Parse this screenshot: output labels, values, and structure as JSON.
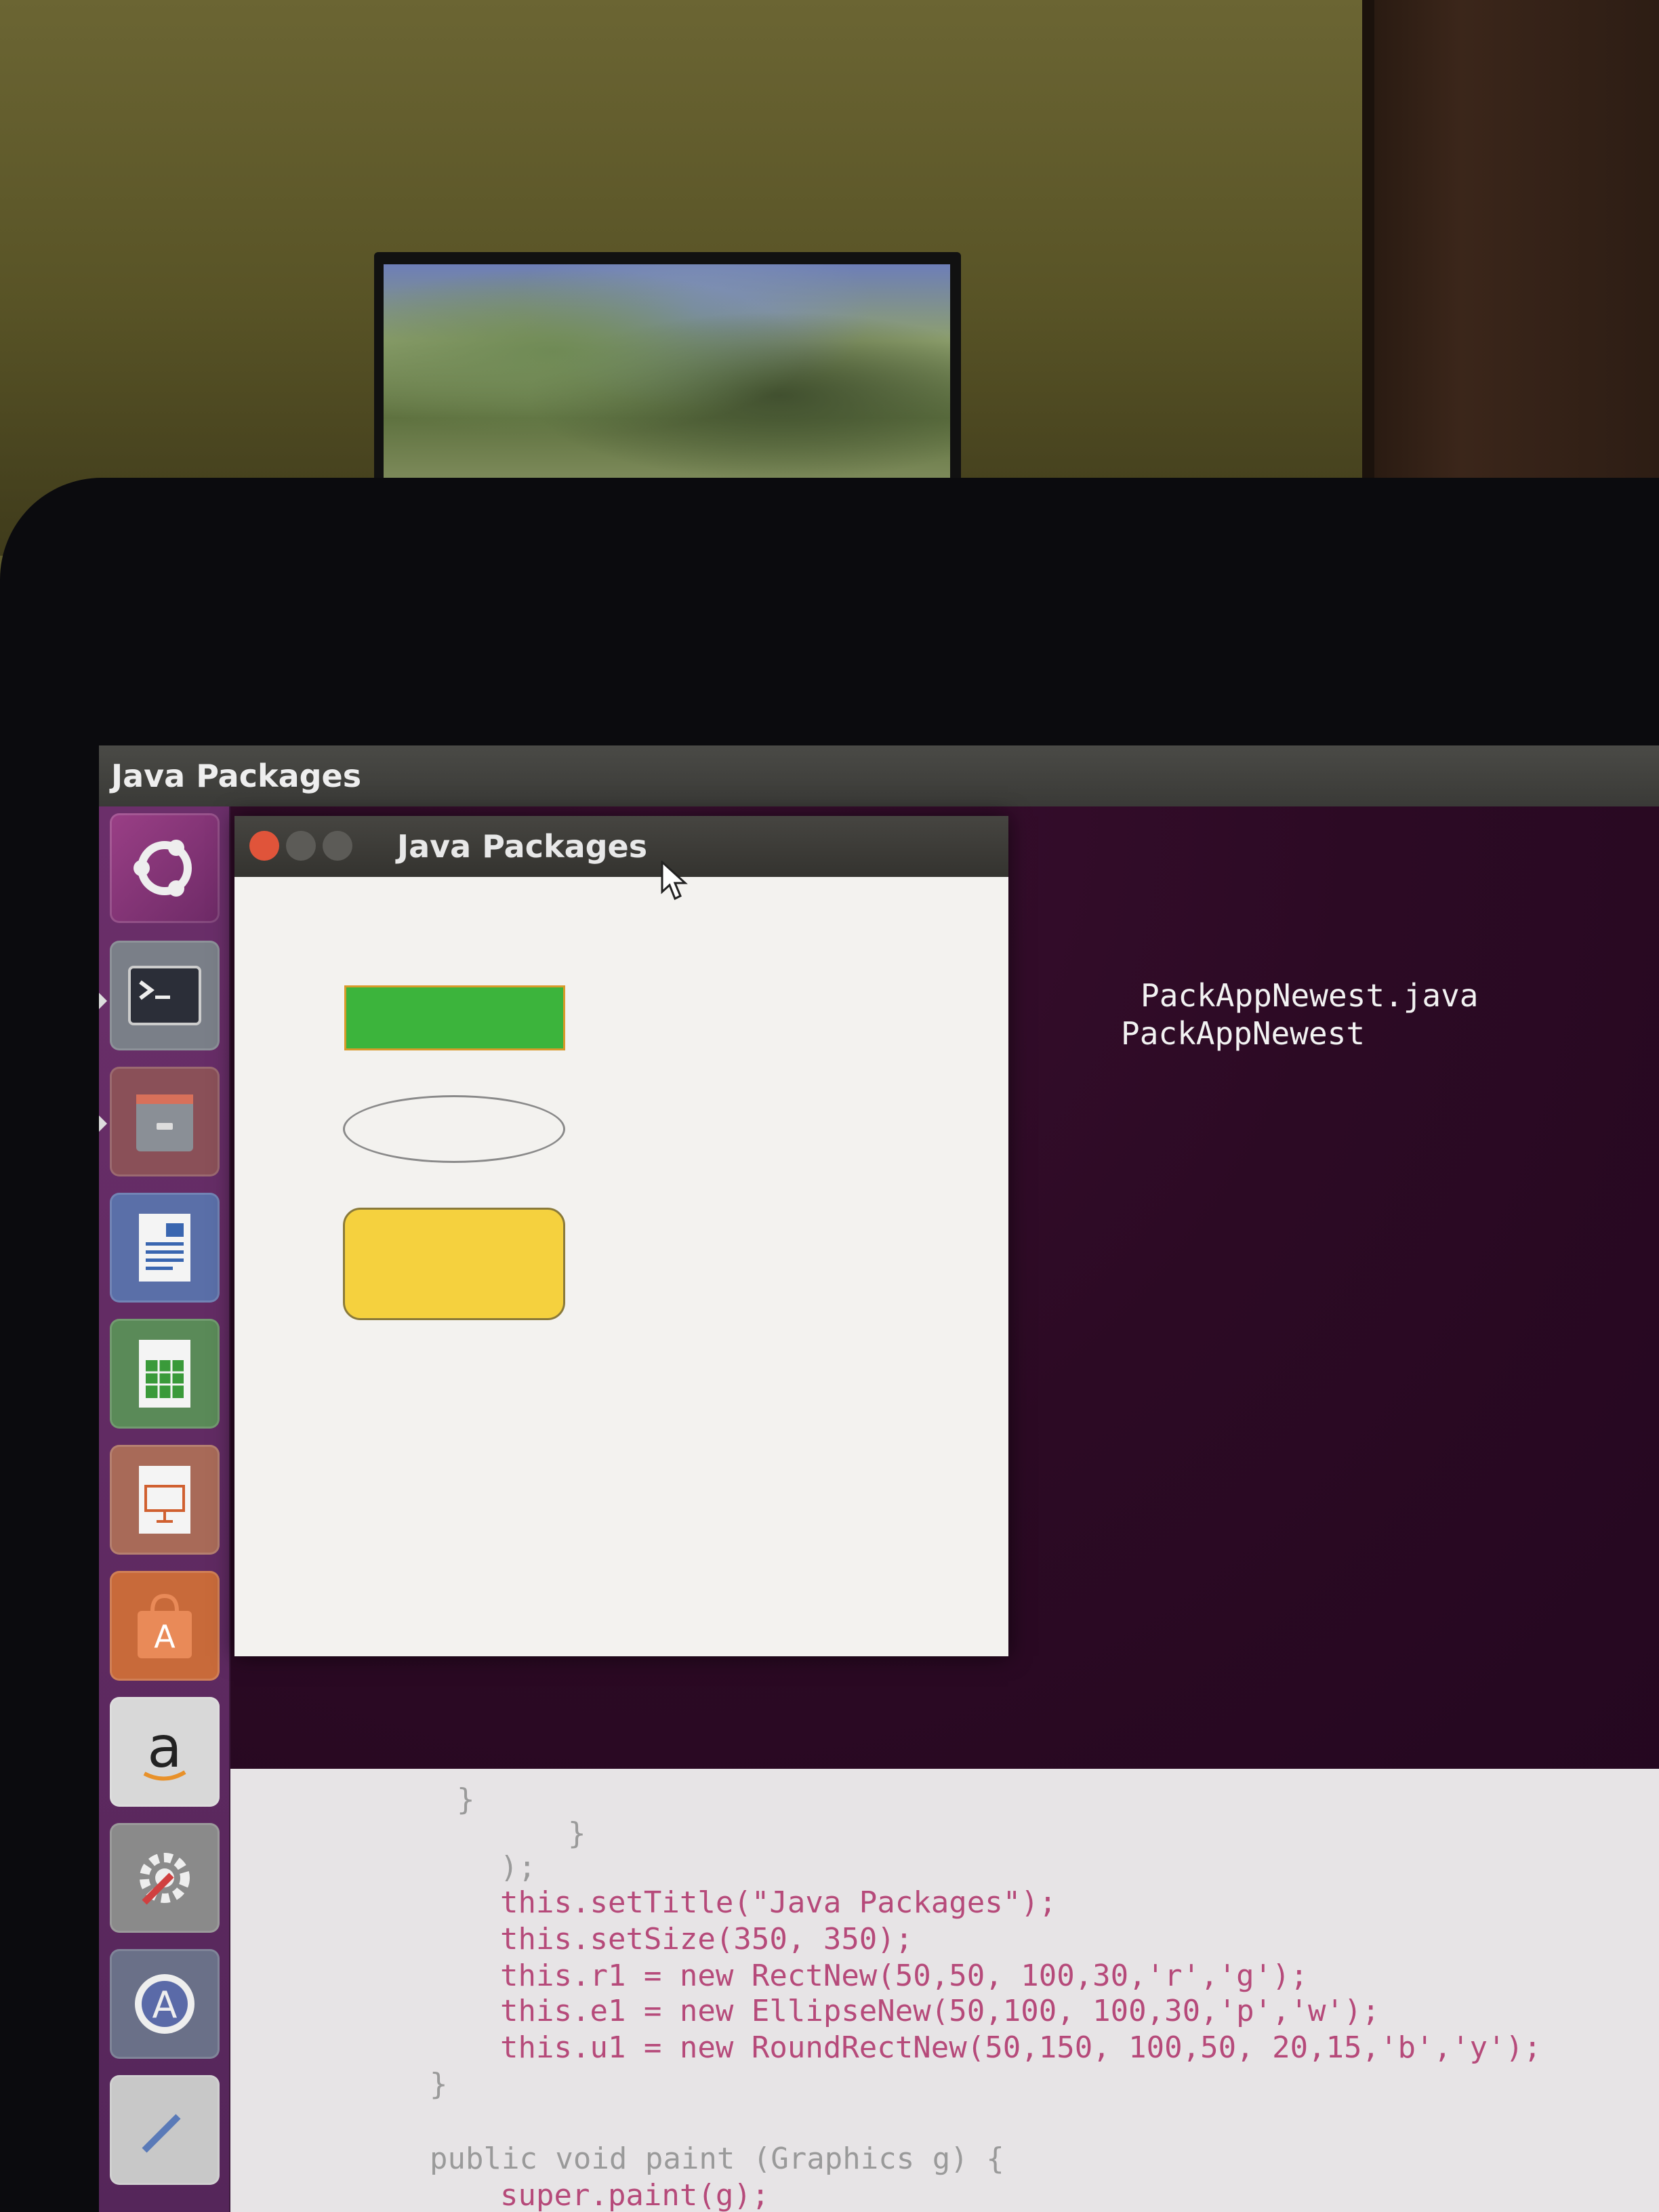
{
  "desktop": {
    "top_bar_title": "Java Packages"
  },
  "launcher": {
    "items": [
      {
        "name": "ubuntu-dash"
      },
      {
        "name": "terminal"
      },
      {
        "name": "files"
      },
      {
        "name": "libreoffice-writer"
      },
      {
        "name": "libreoffice-calc"
      },
      {
        "name": "libreoffice-impress"
      },
      {
        "name": "ubuntu-software-center"
      },
      {
        "name": "amazon"
      },
      {
        "name": "system-settings"
      },
      {
        "name": "software-updater"
      },
      {
        "name": "text-editor"
      }
    ]
  },
  "terminal": {
    "lines": [
      "PackAppNewest.java",
      "PackAppNewest"
    ]
  },
  "java_window": {
    "title": "Java Packages",
    "shapes": {
      "rect": {
        "fill": "#3cb43c",
        "border": "#d89a2a"
      },
      "ellipse": {
        "fill": "#f3f2ef",
        "border": "#8a8a8a"
      },
      "round_rect": {
        "fill": "#f5d13e",
        "border": "#8a7a3a"
      }
    }
  },
  "editor": {
    "lines": [
      "}",
      "}",
      ");",
      "this.setTitle(\"Java Packages\");",
      "this.setSize(350, 350);",
      "this.r1 = new RectNew(50,50, 100,30,'r','g');",
      "this.e1 = new EllipseNew(50,100, 100,30,'p','w');",
      "this.u1 = new RoundRectNew(50,150, 100,50, 20,15,'b','y');",
      "}",
      "public void paint (Graphics g) {",
      "super.paint(g);"
    ]
  }
}
